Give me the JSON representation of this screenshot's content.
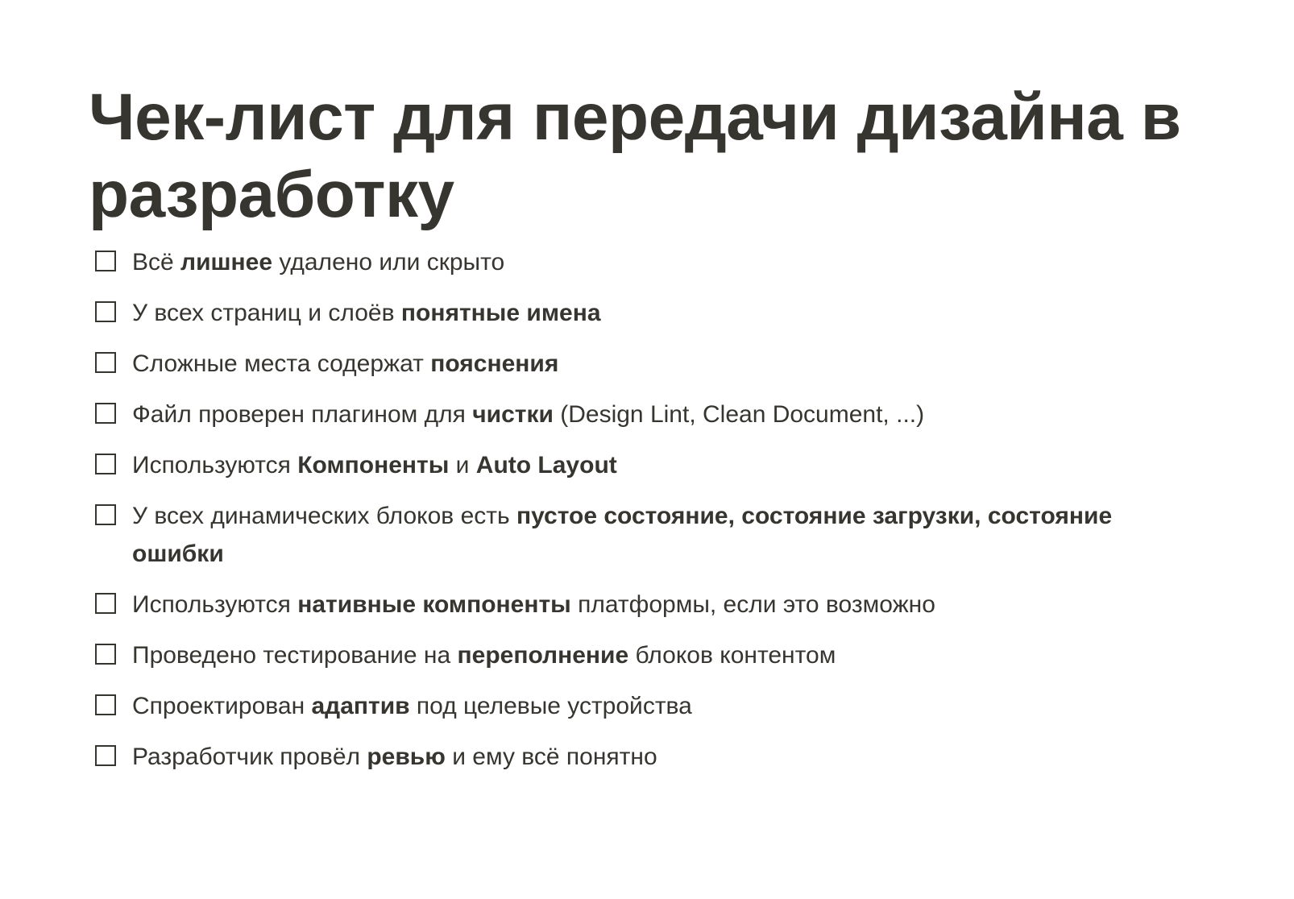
{
  "page": {
    "title": "Чек-лист для передачи дизайна в разработку"
  },
  "checklist": [
    {
      "checked": false,
      "segments": [
        {
          "text": "Всё ",
          "bold": false
        },
        {
          "text": "лишнее",
          "bold": true
        },
        {
          "text": " удалено или скрыто",
          "bold": false
        }
      ]
    },
    {
      "checked": false,
      "segments": [
        {
          "text": "У всех страниц и слоёв ",
          "bold": false
        },
        {
          "text": "понятные имена",
          "bold": true
        }
      ]
    },
    {
      "checked": false,
      "segments": [
        {
          "text": "Сложные места содержат ",
          "bold": false
        },
        {
          "text": "пояснения",
          "bold": true
        }
      ]
    },
    {
      "checked": false,
      "segments": [
        {
          "text": "Файл проверен плагином для ",
          "bold": false
        },
        {
          "text": "чистки",
          "bold": true
        },
        {
          "text": " (Design Lint, Clean Document, ...)",
          "bold": false
        }
      ]
    },
    {
      "checked": false,
      "segments": [
        {
          "text": "Используются ",
          "bold": false
        },
        {
          "text": "Компоненты",
          "bold": true
        },
        {
          "text": " и ",
          "bold": false
        },
        {
          "text": "Auto Layout",
          "bold": true
        }
      ]
    },
    {
      "checked": false,
      "segments": [
        {
          "text": "У всех динамических блоков есть ",
          "bold": false
        },
        {
          "text": "пустое состояние, состояние загрузки, состояние ошибки",
          "bold": true
        }
      ]
    },
    {
      "checked": false,
      "segments": [
        {
          "text": "Используются ",
          "bold": false
        },
        {
          "text": "нативные компоненты",
          "bold": true
        },
        {
          "text": " платформы, если это возможно",
          "bold": false
        }
      ]
    },
    {
      "checked": false,
      "segments": [
        {
          "text": "Проведено тестирование на ",
          "bold": false
        },
        {
          "text": "переполнение",
          "bold": true
        },
        {
          "text": " блоков контентом",
          "bold": false
        }
      ]
    },
    {
      "checked": false,
      "segments": [
        {
          "text": "Спроектирован ",
          "bold": false
        },
        {
          "text": "адаптив",
          "bold": true
        },
        {
          "text": " под целевые устройства",
          "bold": false
        }
      ]
    },
    {
      "checked": false,
      "segments": [
        {
          "text": "Разработчик провёл ",
          "bold": false
        },
        {
          "text": "ревью",
          "bold": true
        },
        {
          "text": " и ему всё понятно",
          "bold": false
        }
      ]
    }
  ]
}
